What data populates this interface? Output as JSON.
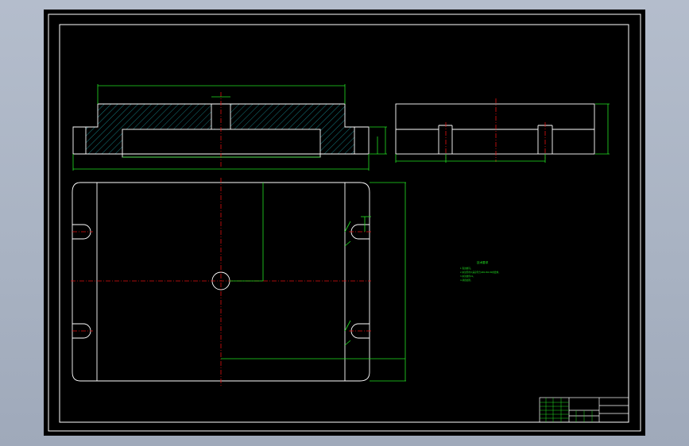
{
  "drawing": {
    "technical_requirements_title": "技术要求",
    "technical_requirements": [
      "1.锐边倒钝。",
      "2.未注形状公差应符合GB1184-80的要求。",
      "3.未注倒角C1。",
      "4.调质处理。"
    ]
  },
  "colors": {
    "background": "#000000",
    "outline": "#ffffff",
    "dimension": "#22e022",
    "centerline": "#e01010",
    "hatch": "#22c8d0",
    "application_frame": "#a9b3c3"
  }
}
